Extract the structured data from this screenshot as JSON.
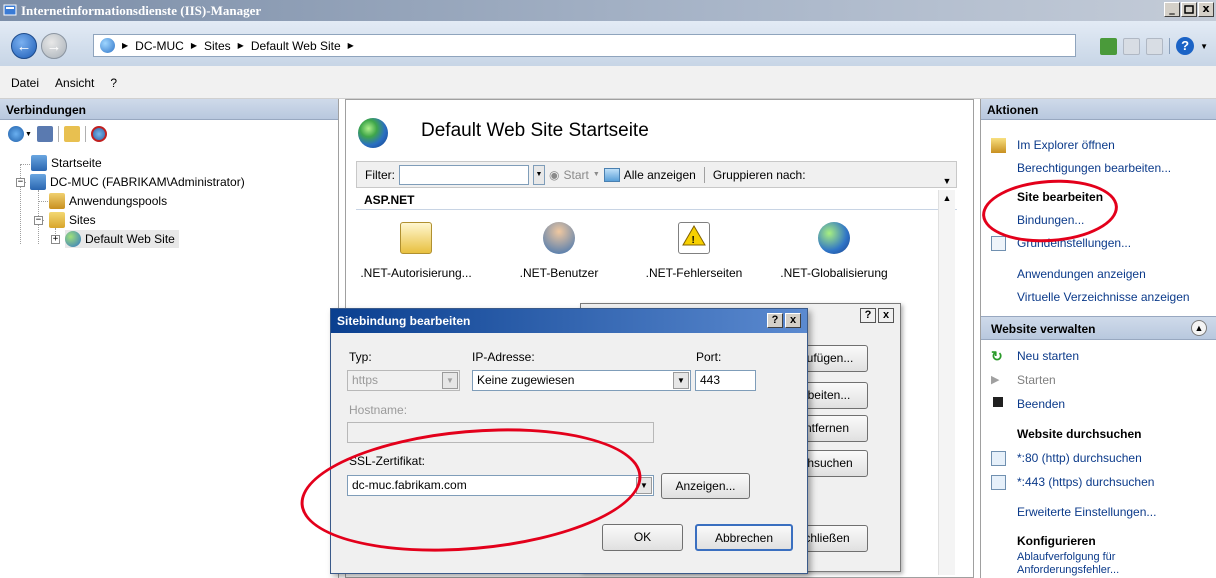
{
  "window": {
    "title": "Internetinformationsdienste (IIS)-Manager",
    "controls": [
      "_",
      "ø",
      "x"
    ]
  },
  "address": {
    "crumbs": [
      "DC-MUC",
      "Sites",
      "Default Web Site"
    ]
  },
  "menu": [
    "Datei",
    "Ansicht",
    "?"
  ],
  "connections": {
    "header": "Verbindungen",
    "tree": {
      "start": "Startseite",
      "server": "DC-MUC (FABRIKAM\\Administrator)",
      "pools": "Anwendungspools",
      "sites": "Sites",
      "site": "Default Web Site"
    }
  },
  "center": {
    "title": "Default Web Site Startseite",
    "filter_label": "Filter:",
    "start": "Start",
    "show_all": "Alle anzeigen",
    "group_by": "Gruppieren nach:",
    "group": "ASP.NET",
    "features": [
      ".NET-Autorisierung...",
      ".NET-Benutzer",
      ".NET-Fehlerseiten",
      ".NET-Globalisierung"
    ]
  },
  "dialog_back": {
    "buttons": [
      "zufügen...",
      "rbeiten...",
      "ntfernen",
      "chsuchen",
      "chließen"
    ]
  },
  "dialog": {
    "title": "Sitebindung bearbeiten",
    "type_label": "Typ:",
    "type_value": "https",
    "ip_label": "IP-Adresse:",
    "ip_value": "Keine zugewiesen",
    "port_label": "Port:",
    "port_value": "443",
    "hostname_label": "Hostname:",
    "ssl_label": "SSL-Zertifikat:",
    "ssl_value": "dc-muc.fabrikam.com",
    "view_button": "Anzeigen...",
    "ok": "OK",
    "cancel": "Abbrechen"
  },
  "actions": {
    "header": "Aktionen",
    "open_explorer": "Im Explorer öffnen",
    "edit_permissions": "Berechtigungen bearbeiten...",
    "edit_site_head": "Site bearbeiten",
    "bindings": "Bindungen...",
    "basic_settings": "Grundeinstellungen...",
    "view_apps": "Anwendungen anzeigen",
    "view_vdirs": "Virtuelle Verzeichnisse anzeigen",
    "manage_section": "Website verwalten",
    "restart": "Neu starten",
    "start": "Starten",
    "stop": "Beenden",
    "browse_head": "Website durchsuchen",
    "browse_http": "*:80 (http) durchsuchen",
    "browse_https": "*:443 (https) durchsuchen",
    "advanced": "Erweiterte Einstellungen...",
    "configure_head": "Konfigurieren",
    "trace_line1": "Ablaufverfolgung für",
    "trace_line2": "Anforderungsfehler..."
  },
  "colors": {
    "annotation_red": "#e3001b",
    "link_blue": "#0b3a8a",
    "title_blue": "#0a3f8f"
  }
}
